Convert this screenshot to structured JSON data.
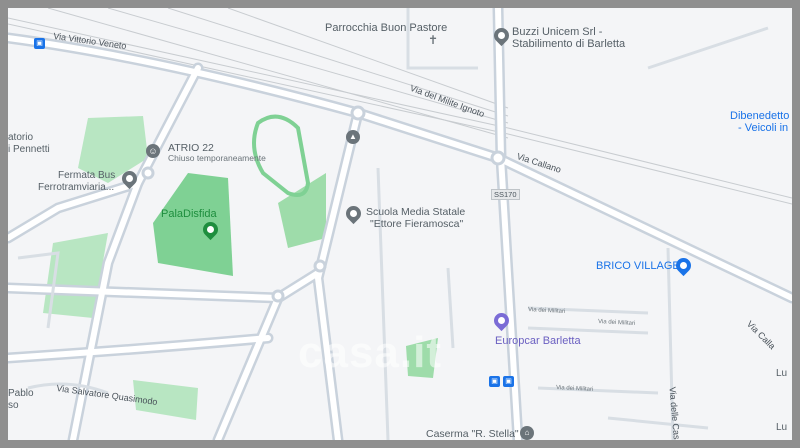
{
  "map": {
    "pois": [
      {
        "id": "parrocchia",
        "label": "Parrocchia Buon Pastore"
      },
      {
        "id": "buzzi",
        "label": "Buzzi Unicem Srl -",
        "label2": "Stabilimento di Barletta"
      },
      {
        "id": "atrio",
        "label": "ATRIO 22",
        "sub": "Chiuso temporaneamente"
      },
      {
        "id": "fermata",
        "label": "Fermata Bus",
        "label2": "Ferrotramviaria..."
      },
      {
        "id": "paladisfida",
        "label": "PalaDisfida"
      },
      {
        "id": "scuola",
        "label": "Scuola Media Statale",
        "label2": "\"Ettore Fieramosca\""
      },
      {
        "id": "brico",
        "label": "BRICO VILLAGE"
      },
      {
        "id": "europcar",
        "label": "Europcar Barletta"
      },
      {
        "id": "caserma",
        "label": "Caserma \"R. Stella\""
      },
      {
        "id": "dibenedetto",
        "label": "Dibenedetto",
        "label2": "- Veicoli in"
      },
      {
        "id": "atorio",
        "label": "atorio",
        "label2": "i Pennetti"
      },
      {
        "id": "pablo",
        "label": "Pablo",
        "label2": "so"
      },
      {
        "id": "lu",
        "label": "Lu"
      },
      {
        "id": "lu2",
        "label": "Lu"
      }
    ],
    "streets": {
      "vittorio_veneto": "Via Vittorio Veneto",
      "milite_ignoto": "Via del Milite Ignoto",
      "callano": "Via Callano",
      "callano2": "Via Calla",
      "militari1": "Via dei Militari",
      "militari2": "Via dei Militari",
      "militari3": "Via dei Militari",
      "quasimodo": "Via Salvatore Quasimodo",
      "delle_cas": "Via delle Cas"
    },
    "road_shield": "SS170",
    "watermark": "casa.it",
    "colors": {
      "background": "#f4f5f7",
      "road": "#ffffff",
      "road_casing": "#c9d2dc",
      "major_road": "#d6dde4",
      "park": "#a6e0b3",
      "park_dark": "#7fd194",
      "rail": "#c3c7cb",
      "poi_gray": "#6b747a",
      "poi_blue": "#1a73e8",
      "poi_green": "#1e8e3e"
    },
    "icons": [
      "bus-stop-icon",
      "pin-icon",
      "school-icon",
      "church-icon",
      "theater-icon",
      "car-rental-icon",
      "shop-icon"
    ]
  }
}
